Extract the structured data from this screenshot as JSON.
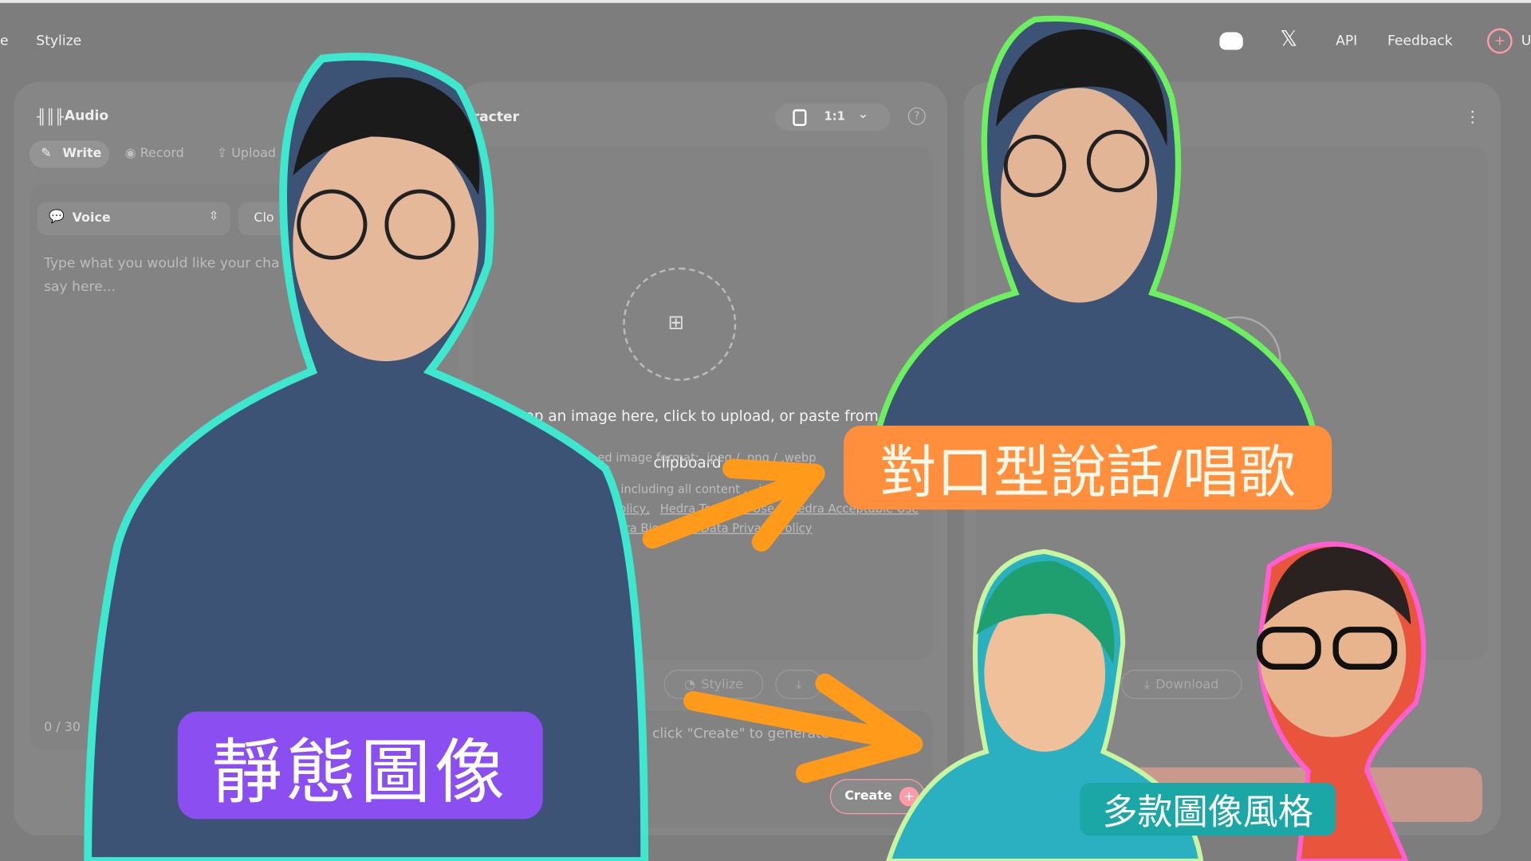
{
  "nav": {
    "tab_partial": "e",
    "stylize": "Stylize",
    "api": "API",
    "feedback": "Feedback",
    "upgrade_partial": "U",
    "icons": [
      "discord-icon",
      "x-icon",
      "sparkle-icon"
    ]
  },
  "audio_panel": {
    "title": "Audio",
    "tabs": [
      "Write",
      "Record",
      "Upload"
    ],
    "voice_label": "Voice",
    "clone_partial": "Clo",
    "placeholder": "Type what you would like your cha say here...",
    "char_count": "0 / 30"
  },
  "character_panel": {
    "title": "racter",
    "aspect": "1:1",
    "upload_line1": "rop an image here, click to upload, or paste from y",
    "upload_line2": "clipboard",
    "formats": "ed image format: .jpeg / .png / .webp",
    "legal_line": ", including all content ... is s",
    "links": [
      "olicy,",
      "Hedra Terms of Use",
      "Hedra Acceptable Use",
      "ra Biometric Data Privacy Policy"
    ],
    "stylize_btn": "Stylize",
    "hint": "click \"Create\" to generate",
    "create_btn": "Create"
  },
  "video_panel": {
    "download_btn": "Download"
  },
  "overlays": {
    "static_image": "靜態圖像",
    "lip_sync": "對口型說話/唱歌",
    "styles": "多款圖像風格"
  },
  "colors": {
    "static_bg": "#8b4ef0",
    "lip_bg": "#ff8f3c",
    "styles_bg": "#1ba7a5",
    "arrow": "#ff9a1a",
    "outline_left": "#3ee8cf",
    "outline_right": "#6cf060",
    "outline_pink": "#ff5fd0"
  }
}
